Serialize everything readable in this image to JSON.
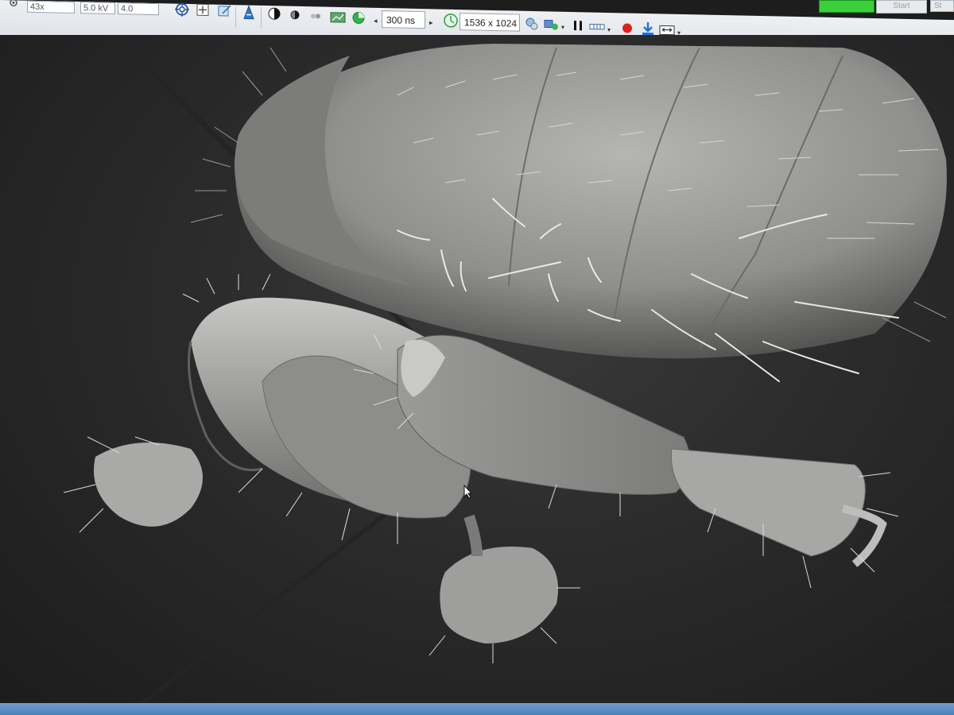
{
  "toolbar": {
    "magnification": "43x",
    "voltage": "5.0 kV",
    "spot": "4.0",
    "dwell_time": "300 ns",
    "resolution": "1536 x 1024",
    "start_label": "Start",
    "cut_label": "St",
    "status_color": "#3ccf3c",
    "icons": [
      "crosshair-target-icon",
      "center-icon",
      "zoom-region-icon",
      "beam-tilt-icon",
      "contrast-icon",
      "brightness-icon",
      "detector-icon",
      "scan-area-icon",
      "pie-scan-icon",
      "scan-speed-icon",
      "grab-frame-icon",
      "detector-select-icon",
      "pause-icon",
      "scan-mode-icon",
      "record-icon",
      "save-download-icon",
      "fit-width-icon"
    ]
  },
  "viewport": {
    "subject": "SEM micrograph"
  },
  "colors": {
    "toolbar_border": "#8fb3da",
    "bottom_bar": "#4d7fb8",
    "record": "#e02020",
    "active_icon": "#1a73d9"
  }
}
